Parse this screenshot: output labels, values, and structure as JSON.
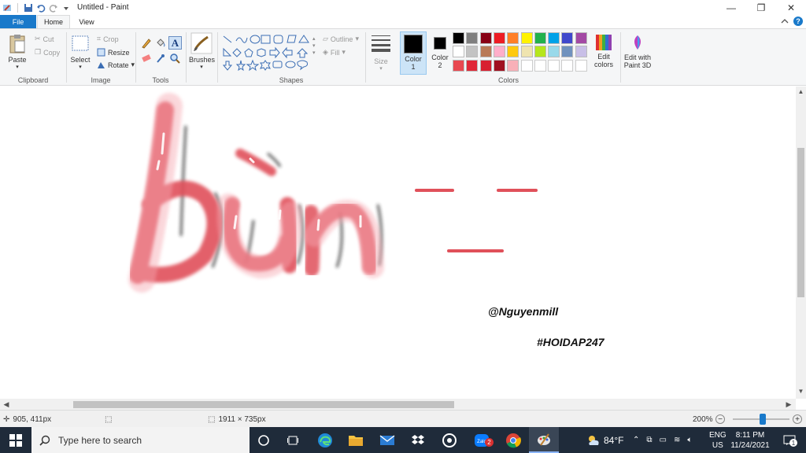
{
  "window": {
    "title": "Untitled - Paint",
    "controls": [
      "—",
      "❐",
      "✕"
    ]
  },
  "tabs": {
    "file": "File",
    "home": "Home",
    "view": "View"
  },
  "ribbon": {
    "clipboard": {
      "label": "Clipboard",
      "paste": "Paste",
      "cut": "Cut",
      "copy": "Copy"
    },
    "image": {
      "label": "Image",
      "select": "Select",
      "crop": "Crop",
      "resize": "Resize",
      "rotate": "Rotate"
    },
    "tools": {
      "label": "Tools"
    },
    "brushes": {
      "label": "Brushes"
    },
    "shapes": {
      "label": "Shapes",
      "outline": "Outline",
      "fill": "Fill"
    },
    "size": {
      "label": "Size"
    },
    "color1": {
      "label1": "Color",
      "label2": "1"
    },
    "color2": {
      "label1": "Color",
      "label2": "2"
    },
    "colors": {
      "label": "Colors",
      "row1": [
        "#000000",
        "#7f7f7f",
        "#880015",
        "#ed1c24",
        "#ff7f27",
        "#fff200",
        "#22b14c",
        "#00a2e8",
        "#3f48cc",
        "#a349a4"
      ],
      "row2": [
        "#ffffff",
        "#c3c3c3",
        "#b97a57",
        "#ffaec9",
        "#ffc90e",
        "#efe4b0",
        "#b5e61d",
        "#99d9ea",
        "#7092be",
        "#c8bfe7"
      ],
      "row3": [
        "#e84850",
        "#e02838",
        "#d82030",
        "#a01020",
        "#f8b0b8",
        "",
        "",
        "",
        "",
        ""
      ]
    },
    "edit_colors": {
      "line1": "Edit",
      "line2": "colors"
    },
    "paint3d": {
      "line1": "Edit with",
      "line2": "Paint 3D"
    }
  },
  "canvas": {
    "handwriting": "bùn",
    "watermark1": "@Nguyenmill",
    "watermark2": "#HOIDAP247",
    "ink_color": "#e0505a"
  },
  "status": {
    "cursor_pos": "905, 411px",
    "image_size": "1911 × 735px",
    "zoom": "200%",
    "zoom_level_percent": 200
  },
  "taskbar": {
    "search_placeholder": "Type here to search",
    "weather": "84°F",
    "lang1": "ENG",
    "lang2": "US",
    "time": "8:11 PM",
    "date": "11/24/2021",
    "zalo_badge": "2",
    "notif_badge": "1"
  }
}
